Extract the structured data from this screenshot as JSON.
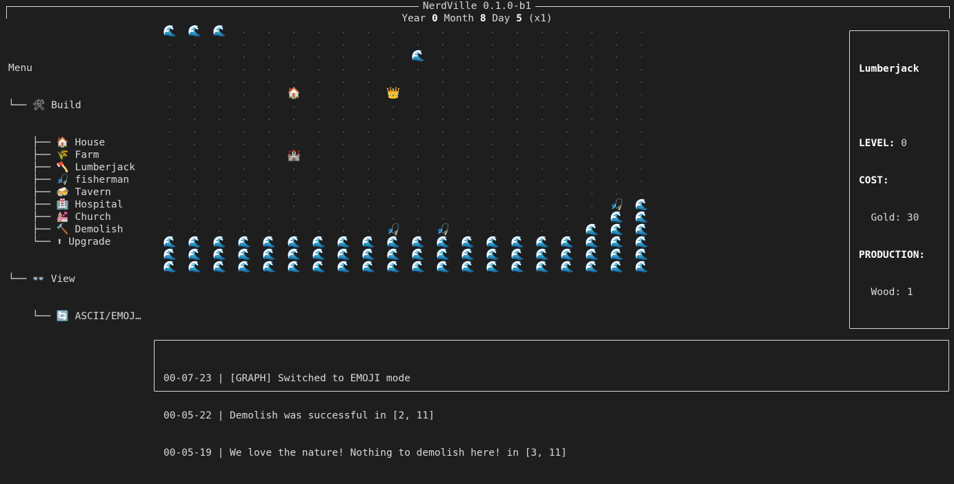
{
  "header": {
    "app_title": "NerdVille 0.1.0-b1",
    "date": {
      "year_label": "Year",
      "year": "0",
      "month_label": "Month",
      "month": "8",
      "day_label": "Day",
      "day": "5",
      "speed": "(x1)"
    }
  },
  "menu": {
    "title": "Menu",
    "build": {
      "icon": "🛠",
      "label": "Build",
      "items": [
        {
          "icon": "🏠",
          "label": "House"
        },
        {
          "icon": "🌾",
          "label": "Farm"
        },
        {
          "icon": "🪓",
          "label": "Lumberjack"
        },
        {
          "icon": "🎣",
          "label": "fisherman"
        },
        {
          "icon": "🍻",
          "label": "Tavern"
        },
        {
          "icon": "🏥",
          "label": "Hospital"
        },
        {
          "icon": "💒",
          "label": "Church"
        },
        {
          "icon": "🔨",
          "label": "Demolish"
        },
        {
          "icon": "⬆",
          "label": "Upgrade"
        }
      ]
    },
    "view": {
      "icon": "👓",
      "label": "View",
      "items": [
        {
          "icon": "🔄",
          "label": "ASCII/EMOJ…"
        }
      ]
    }
  },
  "map": {
    "columns": 20,
    "rows": 20,
    "tiles": {
      "water": "🌊",
      "fisherman": "🎣",
      "house": "🏠",
      "crown": "👑",
      "castle": "🏰"
    },
    "cells": [
      {
        "r": 0,
        "c": 0,
        "t": "water"
      },
      {
        "r": 0,
        "c": 1,
        "t": "water"
      },
      {
        "r": 0,
        "c": 2,
        "t": "water"
      },
      {
        "r": 2,
        "c": 10,
        "t": "water"
      },
      {
        "r": 5,
        "c": 5,
        "t": "house"
      },
      {
        "r": 5,
        "c": 9,
        "t": "crown"
      },
      {
        "r": 10,
        "c": 5,
        "t": "castle"
      },
      {
        "r": 14,
        "c": 18,
        "t": "fisherman"
      },
      {
        "r": 15,
        "c": 19,
        "t": "water"
      },
      {
        "r": 14,
        "c": 19,
        "t": "water"
      },
      {
        "r": 15,
        "c": 18,
        "t": "water"
      },
      {
        "r": 16,
        "c": 9,
        "t": "fisherman"
      },
      {
        "r": 16,
        "c": 11,
        "t": "fisherman"
      },
      {
        "r": 16,
        "c": 17,
        "t": "water"
      },
      {
        "r": 16,
        "c": 18,
        "t": "water"
      },
      {
        "r": 16,
        "c": 19,
        "t": "water"
      },
      {
        "r": 17,
        "c": 0,
        "t": "water"
      },
      {
        "r": 17,
        "c": 1,
        "t": "water"
      },
      {
        "r": 17,
        "c": 2,
        "t": "water"
      },
      {
        "r": 17,
        "c": 3,
        "t": "water"
      },
      {
        "r": 17,
        "c": 4,
        "t": "water"
      },
      {
        "r": 17,
        "c": 5,
        "t": "water"
      },
      {
        "r": 17,
        "c": 6,
        "t": "water"
      },
      {
        "r": 17,
        "c": 7,
        "t": "water"
      },
      {
        "r": 17,
        "c": 8,
        "t": "water"
      },
      {
        "r": 17,
        "c": 9,
        "t": "water"
      },
      {
        "r": 17,
        "c": 10,
        "t": "water"
      },
      {
        "r": 17,
        "c": 11,
        "t": "water"
      },
      {
        "r": 17,
        "c": 12,
        "t": "water"
      },
      {
        "r": 17,
        "c": 13,
        "t": "water"
      },
      {
        "r": 17,
        "c": 14,
        "t": "water"
      },
      {
        "r": 17,
        "c": 15,
        "t": "water"
      },
      {
        "r": 17,
        "c": 16,
        "t": "water"
      },
      {
        "r": 17,
        "c": 17,
        "t": "water"
      },
      {
        "r": 17,
        "c": 18,
        "t": "water"
      },
      {
        "r": 17,
        "c": 19,
        "t": "water"
      },
      {
        "r": 18,
        "c": 0,
        "t": "water"
      },
      {
        "r": 18,
        "c": 1,
        "t": "water"
      },
      {
        "r": 18,
        "c": 2,
        "t": "water"
      },
      {
        "r": 18,
        "c": 3,
        "t": "water"
      },
      {
        "r": 18,
        "c": 4,
        "t": "water"
      },
      {
        "r": 18,
        "c": 5,
        "t": "water"
      },
      {
        "r": 18,
        "c": 6,
        "t": "water"
      },
      {
        "r": 18,
        "c": 7,
        "t": "water"
      },
      {
        "r": 18,
        "c": 8,
        "t": "water"
      },
      {
        "r": 18,
        "c": 9,
        "t": "water"
      },
      {
        "r": 18,
        "c": 10,
        "t": "water"
      },
      {
        "r": 18,
        "c": 11,
        "t": "water"
      },
      {
        "r": 18,
        "c": 12,
        "t": "water"
      },
      {
        "r": 18,
        "c": 13,
        "t": "water"
      },
      {
        "r": 18,
        "c": 14,
        "t": "water"
      },
      {
        "r": 18,
        "c": 15,
        "t": "water"
      },
      {
        "r": 18,
        "c": 16,
        "t": "water"
      },
      {
        "r": 18,
        "c": 17,
        "t": "water"
      },
      {
        "r": 18,
        "c": 18,
        "t": "water"
      },
      {
        "r": 18,
        "c": 19,
        "t": "water"
      },
      {
        "r": 19,
        "c": 0,
        "t": "water"
      },
      {
        "r": 19,
        "c": 1,
        "t": "water"
      },
      {
        "r": 19,
        "c": 2,
        "t": "water"
      },
      {
        "r": 19,
        "c": 3,
        "t": "water"
      },
      {
        "r": 19,
        "c": 4,
        "t": "water"
      },
      {
        "r": 19,
        "c": 5,
        "t": "water"
      },
      {
        "r": 19,
        "c": 6,
        "t": "water"
      },
      {
        "r": 19,
        "c": 7,
        "t": "water"
      },
      {
        "r": 19,
        "c": 8,
        "t": "water"
      },
      {
        "r": 19,
        "c": 9,
        "t": "water"
      },
      {
        "r": 19,
        "c": 10,
        "t": "water"
      },
      {
        "r": 19,
        "c": 11,
        "t": "water"
      },
      {
        "r": 19,
        "c": 12,
        "t": "water"
      },
      {
        "r": 19,
        "c": 13,
        "t": "water"
      },
      {
        "r": 19,
        "c": 14,
        "t": "water"
      },
      {
        "r": 19,
        "c": 15,
        "t": "water"
      },
      {
        "r": 19,
        "c": 16,
        "t": "water"
      },
      {
        "r": 19,
        "c": 17,
        "t": "water"
      },
      {
        "r": 19,
        "c": 18,
        "t": "water"
      },
      {
        "r": 19,
        "c": 19,
        "t": "water"
      }
    ]
  },
  "info": {
    "title": "Lumberjack",
    "level_label": "LEVEL:",
    "level": "0",
    "cost_label": "COST:",
    "cost_line": "Gold: 30",
    "production_label": "PRODUCTION:",
    "production_line": "Wood: 1"
  },
  "log": {
    "entries": [
      "00-07-23 | [GRAPH] Switched to EMOJI mode",
      "00-05-22 | Demolish was successful in [2, 11]",
      "00-05-19 | We love the nature! Nothing to demolish here! in [3, 11]"
    ]
  }
}
